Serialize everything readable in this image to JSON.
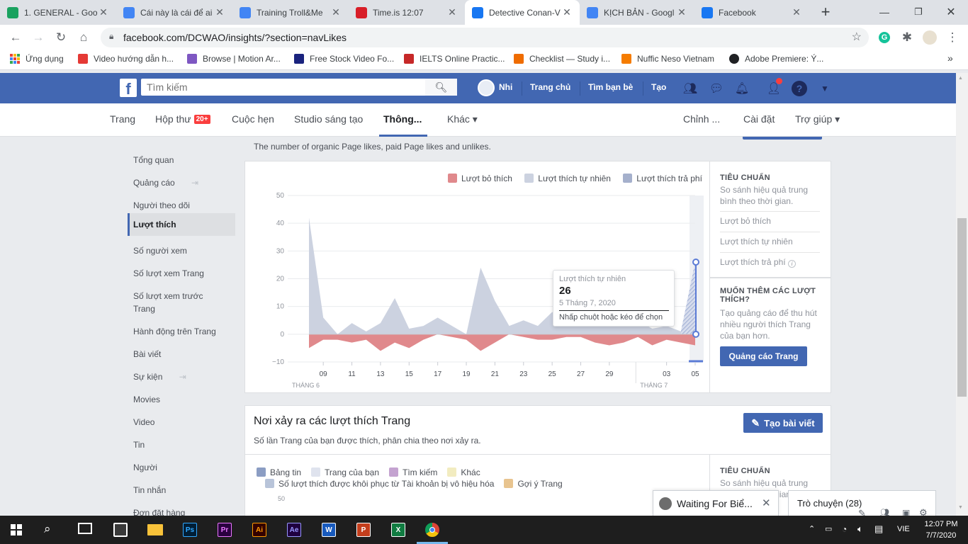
{
  "browser": {
    "tabs": [
      {
        "title": "1. GENERAL - Goo",
        "favicon": "google-drive-icon",
        "color": "#1aa260"
      },
      {
        "title": "Cái này là cái để ai",
        "favicon": "google-docs-icon",
        "color": "#4285f4"
      },
      {
        "title": "Training Troll&Me",
        "favicon": "google-docs-icon",
        "color": "#4285f4"
      },
      {
        "title": "Time.is 12:07",
        "favicon": "timeis-icon",
        "color": "#d81e28"
      },
      {
        "title": "Detective Conan-V",
        "favicon": "facebook-icon",
        "color": "#1877f2"
      },
      {
        "title": "KỊCH BẢN - Googl",
        "favicon": "google-docs-icon",
        "color": "#4285f4"
      },
      {
        "title": "Facebook",
        "favicon": "facebook-icon",
        "color": "#1877f2"
      }
    ],
    "new_tab_symbol": "+",
    "url": "facebook.com/DCWAO/insights/?section=navLikes",
    "bookmarks": [
      {
        "label": "Ứng dụng",
        "icon": "apps-grid-icon",
        "color": "#ea4335"
      },
      {
        "label": "Video hướng dẫn h...",
        "icon": "bookmark-icon",
        "color": "#e53935"
      },
      {
        "label": "Browse | Motion Ar...",
        "icon": "motion-array-icon",
        "color": "#7e57c2"
      },
      {
        "label": "Free Stock Video Fo...",
        "icon": "videvo-icon",
        "color": "#1a237e"
      },
      {
        "label": "IELTS Online Practic...",
        "icon": "ielts-icon",
        "color": "#c62828"
      },
      {
        "label": "Checklist — Study i...",
        "icon": "checklist-icon",
        "color": "#ef6c00"
      },
      {
        "label": "Nuffic Neso Vietnam",
        "icon": "nuffic-icon",
        "color": "#f57c00"
      },
      {
        "label": "Adobe Premiere: Ý...",
        "icon": "globe-icon",
        "color": "#202124"
      }
    ],
    "more_bookmarks": "»"
  },
  "fb": {
    "search_placeholder": "Tìm kiếm",
    "user_name": "Nhi",
    "nav": [
      "Trang chủ",
      "Tìm bạn bè",
      "Tạo"
    ]
  },
  "page_tabs": {
    "items": [
      "Trang",
      "Hộp thư",
      "Cuộc hẹn",
      "Studio sáng tạo",
      "Thông...",
      "Khác ▾"
    ],
    "inbox_badge": "20+",
    "right": [
      "Chỉnh ...",
      "Cài đặt",
      "Trợ giúp ▾"
    ]
  },
  "sidebar": [
    "Tổng quan",
    "Quảng cáo",
    "Người theo dõi",
    "Lượt thích",
    "Số người xem",
    "Số lượt xem Trang",
    "Số lượt xem trước Trang",
    "Hành động trên Trang",
    "Bài viết",
    "Sự kiện",
    "Movies",
    "Video",
    "Tin",
    "Người",
    "Tin nhắn",
    "Đơn đặt hàng"
  ],
  "likes_section": {
    "description": "The number of organic Page likes, paid Page likes and unlikes.",
    "legend": [
      "Lượt bỏ thích",
      "Lượt thích tự nhiên",
      "Lượt thích trả phí"
    ],
    "tooltip": {
      "series": "Lượt thích tự nhiên",
      "value": "26",
      "date": "5 Tháng 7, 2020",
      "hint": "Nhấp chuột hoặc kéo để chọn"
    },
    "benchmark": {
      "title": "TIÊU CHUẨN",
      "desc": "So sánh hiệu quả trung bình theo thời gian.",
      "items": [
        "Lượt bỏ thích",
        "Lượt thích tự nhiên",
        "Lượt thích trả phí"
      ]
    },
    "promo": {
      "title": "MUỐN THÊM CÁC LƯỢT THÍCH?",
      "desc": "Tạo quảng cáo để thu hút nhiều người thích Trang của bạn hơn.",
      "button": "Quảng cáo Trang"
    }
  },
  "chart_data": {
    "type": "area",
    "yticks": [
      "50",
      "40",
      "30",
      "20",
      "10",
      "0",
      "−10"
    ],
    "ylim": [
      -10,
      50
    ],
    "xtick_labels": [
      "09",
      "11",
      "13",
      "15",
      "17",
      "19",
      "21",
      "23",
      "25",
      "27",
      "29",
      "03",
      "05"
    ],
    "month_labels": [
      "THÁNG 6",
      "THÁNG 7"
    ],
    "x": [
      "06-08",
      "06-09",
      "06-10",
      "06-11",
      "06-12",
      "06-13",
      "06-14",
      "06-15",
      "06-16",
      "06-17",
      "06-18",
      "06-19",
      "06-20",
      "06-21",
      "06-22",
      "06-23",
      "06-24",
      "06-25",
      "06-26",
      "06-27",
      "06-28",
      "06-29",
      "06-30",
      "07-01",
      "07-02",
      "07-03",
      "07-04",
      "07-05"
    ],
    "series": [
      {
        "name": "Lượt thích tự nhiên",
        "color": "#ccd2e0",
        "values": [
          42,
          6,
          0,
          4,
          1,
          4,
          13,
          2,
          3,
          6,
          3,
          0,
          24,
          12,
          3,
          5,
          3,
          8,
          5,
          4,
          4,
          3,
          4,
          5,
          2,
          3,
          1,
          26
        ]
      },
      {
        "name": "Lượt bỏ thích",
        "color": "#e0898c",
        "values": [
          -5,
          -2,
          -2,
          -3,
          -2,
          -6,
          -3,
          -5,
          -2,
          0,
          -1,
          -2,
          -6,
          -3,
          0,
          -1,
          -2,
          -2,
          -1,
          -1,
          -3,
          -4,
          -3,
          -1,
          -4,
          -2,
          -3,
          -4
        ]
      },
      {
        "name": "Lượt thích trả phí",
        "color": "#a5b0cc",
        "values": [
          0,
          0,
          0,
          0,
          0,
          0,
          0,
          0,
          0,
          0,
          0,
          0,
          0,
          0,
          0,
          0,
          0,
          0,
          0,
          0,
          0,
          0,
          0,
          0,
          0,
          0,
          0,
          0
        ]
      }
    ]
  },
  "places_section": {
    "title": "Nơi xảy ra các lượt thích Trang",
    "create_post": "Tạo bài viết",
    "description": "Số lần Trang của bạn được thích, phân chia theo nơi xảy ra.",
    "legend": [
      {
        "label": "Bảng tin",
        "color": "#8b9dc3"
      },
      {
        "label": "Trang của bạn",
        "color": "#dfe3ee"
      },
      {
        "label": "Tìm kiếm",
        "color": "#c4a3d0"
      },
      {
        "label": "Khác",
        "color": "#f2ecc0"
      },
      {
        "label": "Số lượt thích được khôi phục từ Tài khoản bị vô hiệu hóa",
        "color": "#b8c4d9"
      },
      {
        "label": "Gợi ý Trang",
        "color": "#e8c48f"
      }
    ],
    "ytick_top": "50",
    "benchmark_title": "TIÊU CHUẨN",
    "benchmark_desc": "So sánh hiệu quả trung bình theo thời gian."
  },
  "chat": {
    "popup_title": "Waiting For Biể...",
    "sidebar_label": "Trò chuyện (28)"
  },
  "taskbar": {
    "lang": "VIE",
    "time": "12:07 PM",
    "date": "7/7/2020",
    "apps": [
      {
        "name": "Ps",
        "color": "#001e36",
        "fg": "#31a8ff"
      },
      {
        "name": "Pr",
        "color": "#2a003f",
        "fg": "#ea77ff"
      },
      {
        "name": "Ai",
        "color": "#330000",
        "fg": "#ff9a00"
      },
      {
        "name": "Ae",
        "color": "#1f0040",
        "fg": "#9999ff"
      },
      {
        "name": "W",
        "color": "#185abd",
        "fg": "#ffffff"
      },
      {
        "name": "P",
        "color": "#c43e1c",
        "fg": "#ffffff"
      },
      {
        "name": "X",
        "color": "#107c41",
        "fg": "#ffffff"
      }
    ]
  }
}
